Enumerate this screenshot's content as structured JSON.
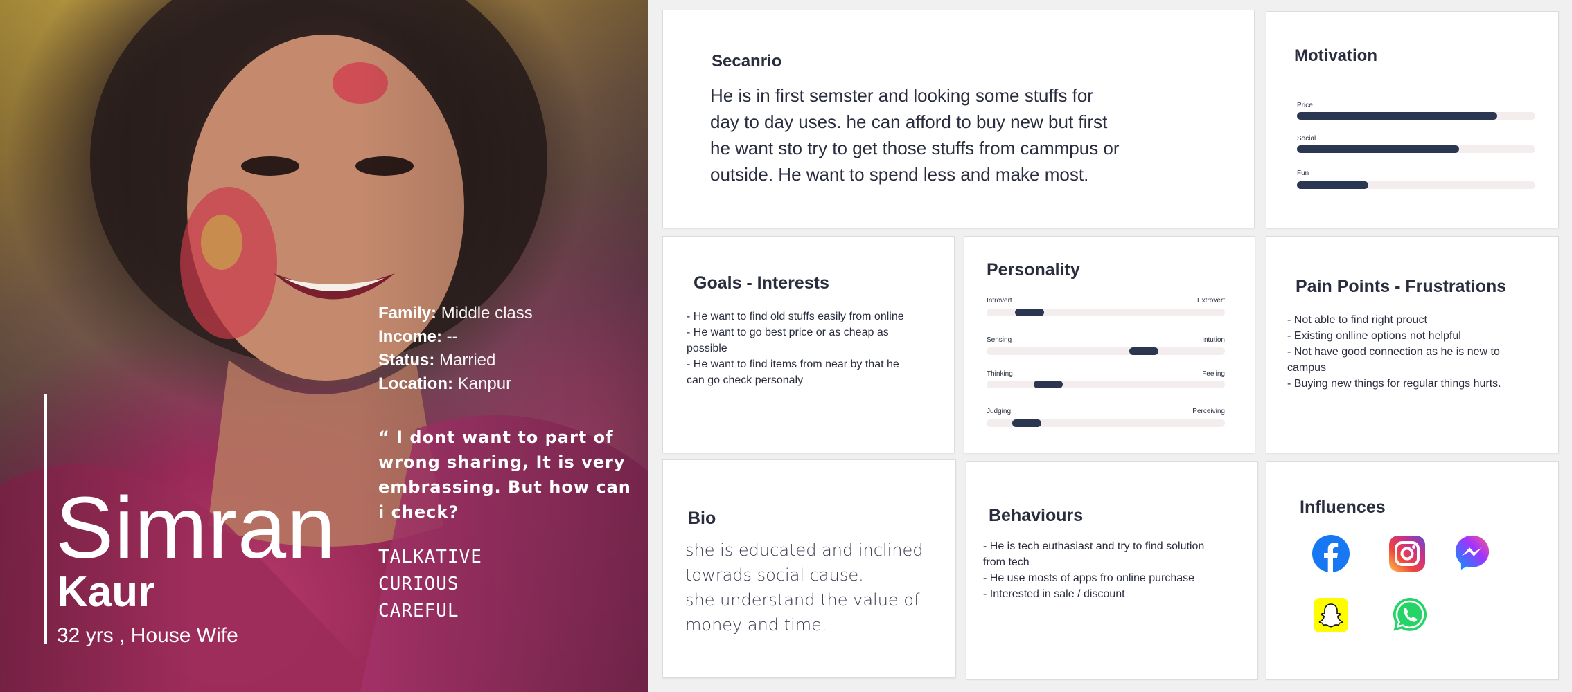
{
  "persona": {
    "first_name": "Simran",
    "last_name": "Kaur",
    "age_role": "32 yrs , House Wife",
    "demographics": [
      {
        "key": "Family:",
        "value": " Middle class"
      },
      {
        "key": "Income:",
        "value": " --"
      },
      {
        "key": "Status:",
        "value": " Married"
      },
      {
        "key": "Location:",
        "value": " Kanpur"
      }
    ],
    "quote": "“ I dont want to part of wrong sharing, It is very embrassing. But how can i check?",
    "traits": [
      "TALKATIVE",
      "CURIOUS",
      "CAREFUL"
    ]
  },
  "scenario": {
    "title": "Secanrio",
    "lines": [
      "He is in first semster and looking some stuffs for",
      "day to day uses. he can afford to buy new but first",
      "he want sto try to get those stuffs from cammpus or",
      "outside. He want to spend less and make most."
    ]
  },
  "motivation": {
    "title": "Motivation",
    "items": [
      {
        "label": "Price",
        "level": 0.84
      },
      {
        "label": "Social",
        "level": 0.68
      },
      {
        "label": "Fun",
        "level": 0.3
      }
    ]
  },
  "goals": {
    "title": "Goals - Interests",
    "lines": [
      "- He want to find old stuffs easily from online",
      "- He want to go best price or as cheap as",
      "possible",
      "- He  want to find items from near by that he",
      "can go check personaly"
    ]
  },
  "personality": {
    "title": "Personality",
    "items": [
      {
        "left": "Introvert",
        "right": "Extrovert",
        "level": 0.18
      },
      {
        "left": "Sensing",
        "right": "Intution",
        "level": 0.66
      },
      {
        "left": "Thinking",
        "right": "Feeling",
        "level": 0.26
      },
      {
        "left": "Judging",
        "right": "Perceiving",
        "level": 0.17
      }
    ]
  },
  "pain_points": {
    "title": "Pain Points - Frustrations",
    "lines": [
      "- Not able to find right prouct",
      "-  Existing onlline options not helpful",
      "-  Not have good connection as he is new to",
      "campus",
      "-  Buying new things for regular things hurts."
    ]
  },
  "bio": {
    "title": "Bio",
    "lines": [
      "she is educated and inclined",
      "towrads social cause.",
      "she understand the value of",
      "money and time."
    ]
  },
  "behaviours": {
    "title": "Behaviours",
    "lines": [
      "- He is tech euthasiast and try to find solution",
      "from tech",
      "-  He use mosts of apps fro online purchase",
      "-  Interested in sale / discount"
    ]
  },
  "influences": {
    "title": "Influences",
    "icons": [
      "facebook-icon",
      "instagram-icon",
      "messenger-icon",
      "snapchat-icon",
      "whatsapp-icon"
    ]
  },
  "colors": {
    "accent_bar": "#2b3650",
    "track": "#f3eded",
    "text": "#2a2d3e",
    "facebook": "#1877f2",
    "snapchat": "#fffc00",
    "whatsapp": "#25d366"
  }
}
